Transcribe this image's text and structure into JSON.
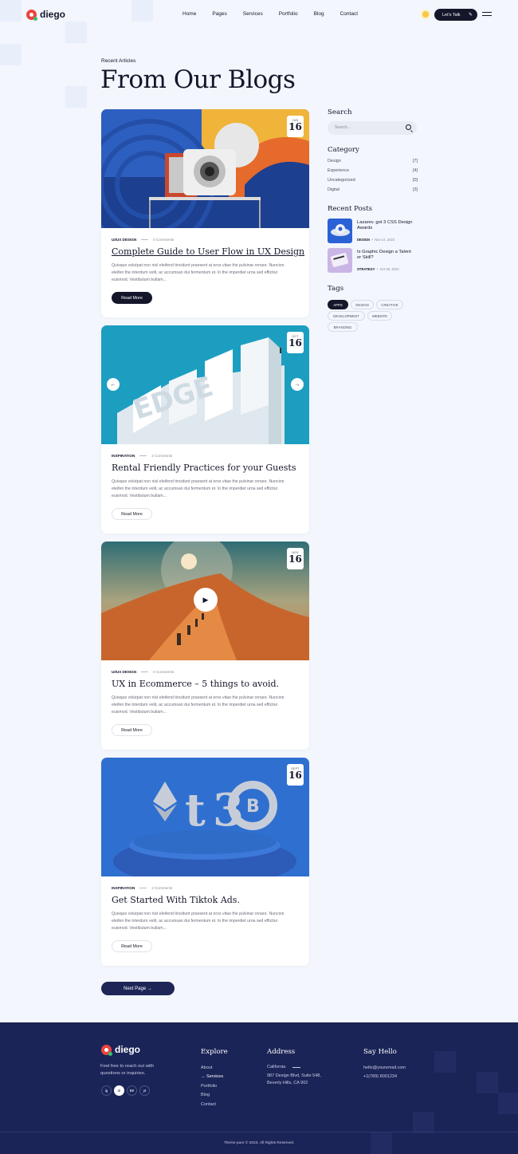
{
  "brand": {
    "name": "diego"
  },
  "nav": {
    "items": [
      "Home",
      "Pages",
      "Services",
      "Portfolio",
      "Blog",
      "Contact"
    ]
  },
  "header": {
    "cta_label": "Let's Talk"
  },
  "page": {
    "eyebrow": "Recent Articles",
    "title": "From Our Blogs"
  },
  "posts": [
    {
      "month": "JUN",
      "day": "16",
      "category": "UI/UX DESIGN",
      "comments": "0 Comments",
      "title": "Complete Guide to User Flow in UX Design",
      "excerpt": "Quisque volutpat non nisl eleifend tincidunt praesent at eros vitae the pulvinar ornare. Nuncion eleifen the interdum velit, ac accumsan dui fermentum et. In the imperdiet urna sed efficitur euismod. Vestibulum bullam...",
      "read_more": "Read More"
    },
    {
      "month": "OCT",
      "day": "16",
      "category": "INSPIRATION",
      "comments": "2 Comments",
      "title": "Rental Friendly Practices for your Guests",
      "excerpt": "Quisque volutpat non nisl eleifend tincidunt praesent at eros vitae the pulvinar ornare. Nuncion eleifen the interdum velit, ac accumsan dui fermentum et. In the imperdiet urna sed efficitur euismod. Vestibulum bullam...",
      "read_more": "Read More"
    },
    {
      "month": "NOV",
      "day": "16",
      "category": "UI/UX DESIGN",
      "comments": "0 Comments",
      "title": "UX in Ecommerce – 5 things to avoid.",
      "excerpt": "Quisque volutpat non nisl eleifend tincidunt praesent at eros vitae the pulvinar ornare. Nuncion eleifen the interdum velit, ac accumsan dui fermentum et. In the imperdiet urna sed efficitur euismod. Vestibulum bullam...",
      "read_more": "Read More"
    },
    {
      "month": "SEPT",
      "day": "16",
      "category": "INSPIRATION",
      "comments": "2 Comments",
      "title": "Get Started With Tiktok Ads.",
      "excerpt": "Quisque volutpat non nisl eleifend tincidunt praesent at eros vitae the pulvinar ornare. Nuncion eleifen the interdum velit, ac accumsan dui fermentum et. In the imperdiet urna sed efficitur euismod. Vestibulum bullam...",
      "read_more": "Read More"
    }
  ],
  "pagination": {
    "next_label": "Next Page"
  },
  "sidebar": {
    "search": {
      "title": "Search",
      "placeholder": "Search..."
    },
    "category": {
      "title": "Category",
      "items": [
        {
          "name": "Design",
          "count": "[7]"
        },
        {
          "name": "Experience",
          "count": "[4]"
        },
        {
          "name": "Uncategorized",
          "count": "[0]"
        },
        {
          "name": "Digital",
          "count": "[3]"
        }
      ]
    },
    "recent_posts": {
      "title": "Recent Posts",
      "items": [
        {
          "title": "Lazarev. got 3 CSS Design Awards",
          "category": "DESIGN",
          "date": "Nov 14, 2023"
        },
        {
          "title": "Is Graphic Design a Talent or Skill?",
          "category": "STRATEGY",
          "date": "Oct 08, 2023"
        }
      ]
    },
    "tags": {
      "title": "Tags",
      "items": [
        "APPS",
        "DESIGN",
        "CREATIVE",
        "DEVELOPMENT",
        "WEBSITE",
        "BRANDING"
      ]
    }
  },
  "footer": {
    "about": "Feel free to reach out with questions or inquiries.",
    "social": [
      "ig",
      "dr",
      "Bē",
      "yt"
    ],
    "explore": {
      "title": "Explore",
      "links": [
        "About",
        "Services",
        "Portfolio",
        "Blog",
        "Contact"
      ]
    },
    "address": {
      "title": "Address",
      "city": "California",
      "line1": "987 Design Blvd, Suite 548,",
      "line2": "Beverly Hills, CA 902"
    },
    "say_hello": {
      "title": "Say Hello",
      "email": "hello@youremail.com",
      "phone": "+1(789) 8001234"
    },
    "copyright": "Theme pure © 2023. All Rights Reserved."
  },
  "colors": {
    "dark": "#14162a",
    "footer": "#1b2457",
    "accent": "#e9453f"
  }
}
